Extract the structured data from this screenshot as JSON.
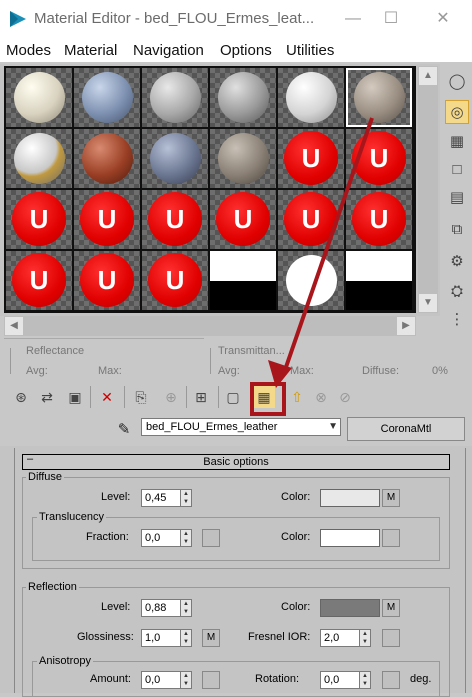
{
  "window": {
    "title": "Material Editor - bed_FLOU_Ermes_leat...",
    "minimize": "—",
    "maximize": "☐",
    "close": "✕"
  },
  "menu": [
    "Modes",
    "Material",
    "Navigation",
    "Options",
    "Utilities"
  ],
  "slots": {
    "badge_letter": "U"
  },
  "info": {
    "reflectance_label": "Reflectance",
    "avg_label": "Avg:",
    "max_label": "Max:",
    "transmittance_label": "Transmittan...",
    "avg2_label": "Avg:",
    "max2_label": "Max:",
    "diffuse_label": "Diffuse:",
    "diffuse_value": "0%"
  },
  "material": {
    "name": "bed_FLOU_Ermes_leather",
    "type": "CoronaMtl"
  },
  "rollout": {
    "collapse_symbol": "–",
    "title": "Basic options"
  },
  "diffuse": {
    "group_title": "Diffuse",
    "level_label": "Level:",
    "level_value": "0,45",
    "color_label": "Color:",
    "color": "#e8e8e8",
    "map_button": "M",
    "translucency": {
      "group_title": "Translucency",
      "fraction_label": "Fraction:",
      "fraction_value": "0,0",
      "color_label": "Color:",
      "color": "#ffffff"
    }
  },
  "reflection": {
    "group_title": "Reflection",
    "level_label": "Level:",
    "level_value": "0,88",
    "color_label": "Color:",
    "color": "#7a7a7a",
    "map_button": "M",
    "glossiness_label": "Glossiness:",
    "glossiness_value": "1,0",
    "glossiness_map_button": "M",
    "fresnel_label": "Fresnel IOR:",
    "fresnel_value": "2,0",
    "anisotropy": {
      "group_title": "Anisotropy",
      "amount_label": "Amount:",
      "amount_value": "0,0",
      "rotation_label": "Rotation:",
      "rotation_value": "0,0",
      "deg_label": "deg."
    }
  },
  "colors": {
    "highlight_annotation": "#a8161c",
    "active_tool": "#f5d98a",
    "badge_red": "#e00000"
  }
}
